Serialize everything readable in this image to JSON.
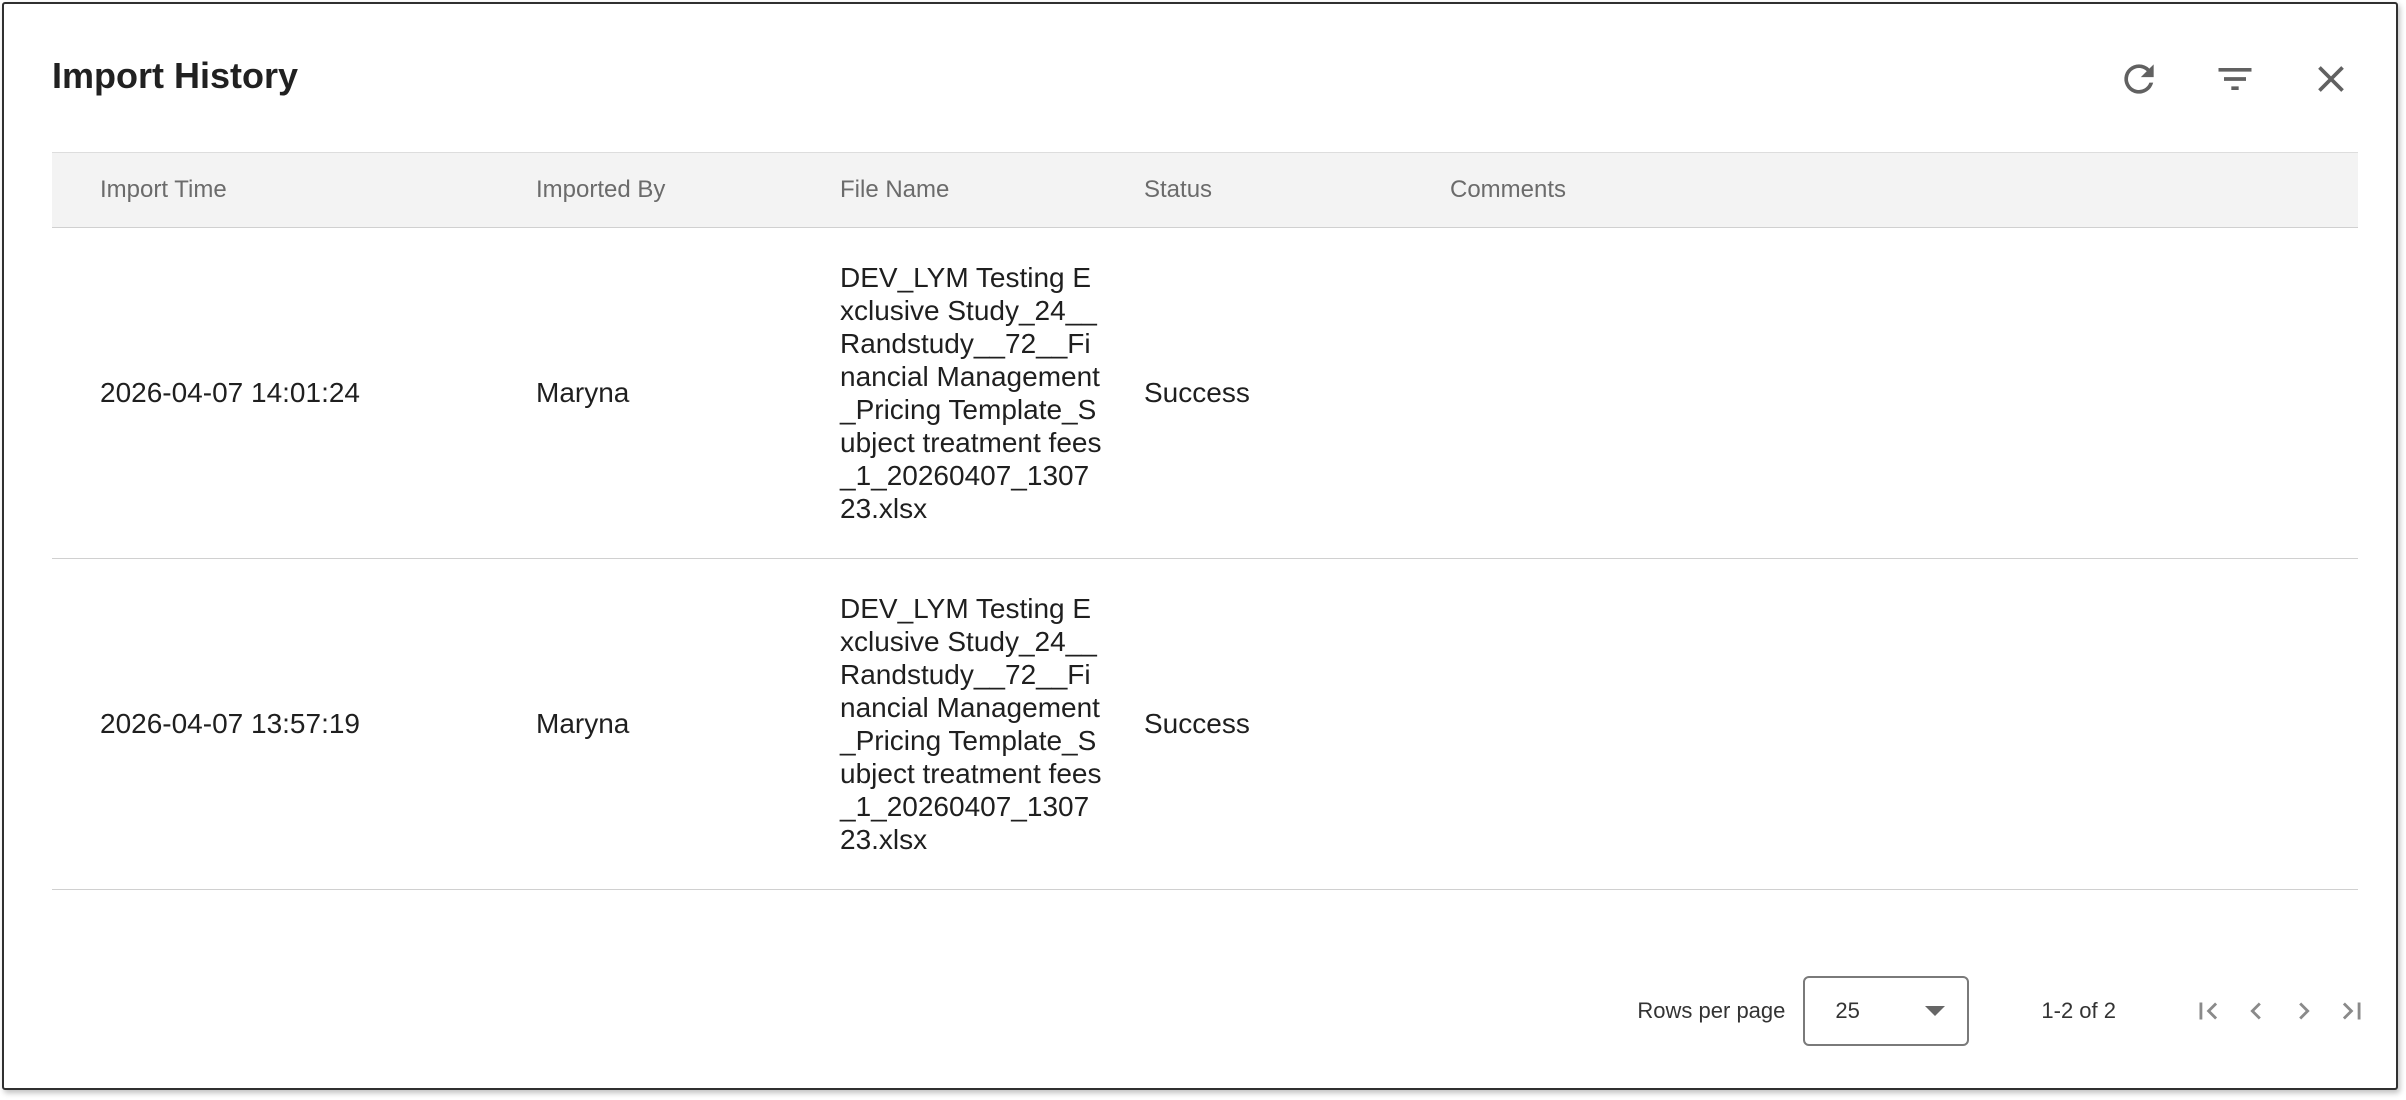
{
  "dialog": {
    "title": "Import History"
  },
  "header_icons": [
    "refresh-icon",
    "filter-icon",
    "close-icon"
  ],
  "table": {
    "columns": [
      "Import Time",
      "Imported By",
      "File Name",
      "Status",
      "Comments"
    ],
    "rows": [
      {
        "import_time": "2026-04-07 14:01:24",
        "imported_by": "Maryna",
        "file_name": "DEV_LYM Testing Exclusive Study_24__Randstudy__72__Financial Management_Pricing Template_Subject treatment fees_1_20260407_130723.xlsx",
        "status": "Success",
        "comments": ""
      },
      {
        "import_time": "2026-04-07 13:57:19",
        "imported_by": "Maryna",
        "file_name": "DEV_LYM Testing Exclusive Study_24__Randstudy__72__Financial Management_Pricing Template_Subject treatment fees_1_20260407_130723.xlsx",
        "status": "Success",
        "comments": ""
      }
    ]
  },
  "pagination": {
    "rows_per_page_label": "Rows per page",
    "rows_per_page_value": "25",
    "range_text": "1-2 of 2"
  },
  "colors": {
    "header_bg": "#f3f3f3",
    "border": "#d0d0d0",
    "text": "#212121",
    "muted": "#6b6b6b"
  }
}
